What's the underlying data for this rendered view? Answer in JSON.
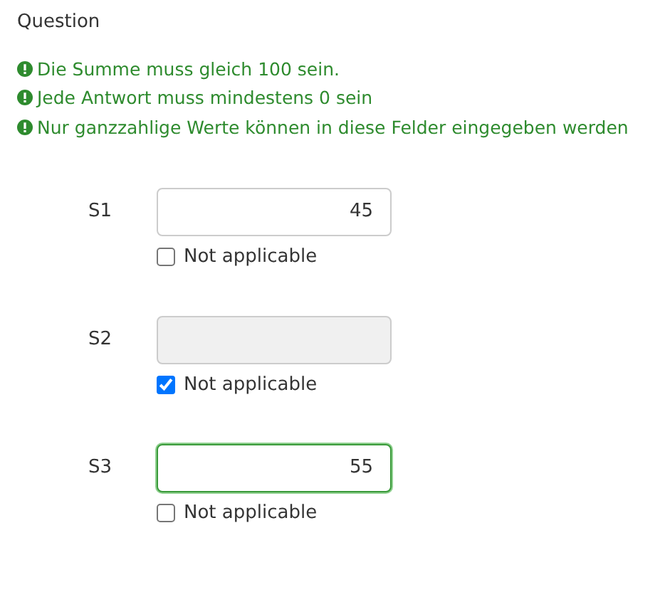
{
  "title": "Question",
  "messages": [
    "Die Summe muss gleich 100 sein.",
    "Jede Antwort muss mindestens 0 sein",
    "Nur ganzzahlige Werte können in diese Felder eingegeben werden"
  ],
  "items": [
    {
      "label": "S1",
      "value": "45",
      "disabled": false,
      "focused": false,
      "na": {
        "label": "Not applicable",
        "checked": false
      }
    },
    {
      "label": "S2",
      "disabled": true,
      "focused": false,
      "na": {
        "label": "Not applicable",
        "checked": true
      }
    },
    {
      "label": "S3",
      "value": "55",
      "disabled": false,
      "focused": true,
      "na": {
        "label": "Not applicable",
        "checked": false
      }
    }
  ]
}
